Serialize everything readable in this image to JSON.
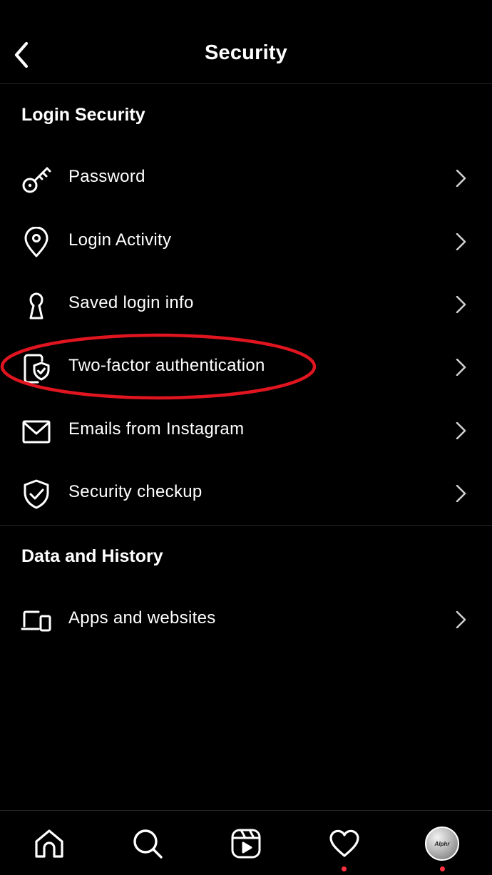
{
  "header": {
    "title": "Security",
    "back_icon": "chevron-left-icon"
  },
  "sections": [
    {
      "title": "Login Security",
      "items": [
        {
          "label": "Password",
          "icon": "key-icon"
        },
        {
          "label": "Login Activity",
          "icon": "location-pin-icon"
        },
        {
          "label": "Saved login info",
          "icon": "keyhole-icon"
        },
        {
          "label": "Two-factor authentication",
          "icon": "phone-shield-icon",
          "highlighted": true
        },
        {
          "label": "Emails from Instagram",
          "icon": "envelope-icon"
        },
        {
          "label": "Security checkup",
          "icon": "shield-check-icon"
        }
      ]
    },
    {
      "title": "Data and History",
      "items": [
        {
          "label": "Apps and websites",
          "icon": "devices-icon"
        }
      ]
    }
  ],
  "tabbar": {
    "tabs": [
      {
        "name": "home",
        "icon": "home-icon"
      },
      {
        "name": "search",
        "icon": "search-icon"
      },
      {
        "name": "reels",
        "icon": "reels-icon"
      },
      {
        "name": "activity",
        "icon": "heart-icon",
        "notification": true
      },
      {
        "name": "profile",
        "icon": "avatar",
        "notification": true,
        "avatar_text": "Alphr"
      }
    ]
  },
  "colors": {
    "background": "#000000",
    "text": "#ffffff",
    "divider": "#262626",
    "highlight": "#e0151f",
    "notification_dot": "#ff3040"
  }
}
